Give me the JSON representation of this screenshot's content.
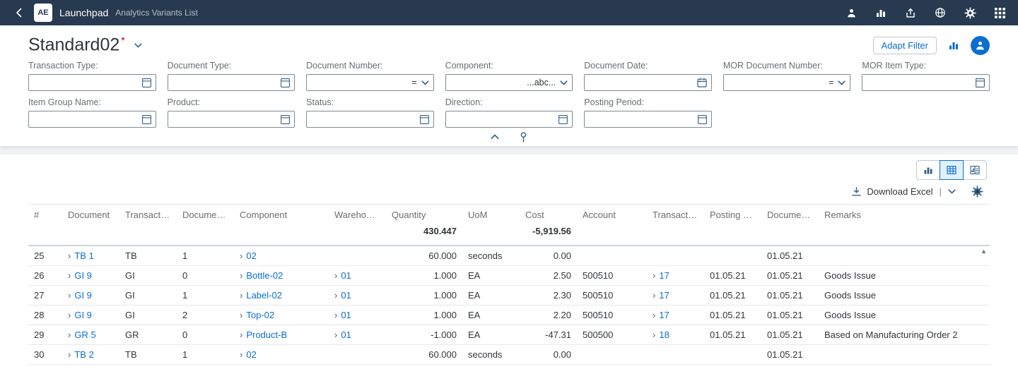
{
  "shell": {
    "app_initials": "AE",
    "title": "Launchpad",
    "subtitle": "Analytics Variants List",
    "actions": [
      "user-icon",
      "bar-chart-icon",
      "export-icon",
      "globe-icon",
      "settings-icon",
      "grid-icon"
    ]
  },
  "header": {
    "variant_title": "Standard02",
    "modified_marker": "*",
    "adapt_filter_label": "Adapt Filter"
  },
  "filter_bar": {
    "fields": [
      {
        "label": "Transaction Type:",
        "value": "",
        "icon": "value-help-icon",
        "row": 1,
        "col": 1
      },
      {
        "label": "Document Type:",
        "value": "",
        "icon": "value-help-icon",
        "row": 1,
        "col": 2
      },
      {
        "label": "Document Number:",
        "value": "",
        "operator": "=",
        "icon": "dropdown-icon",
        "row": 1,
        "col": 3
      },
      {
        "label": "Component:",
        "value": "",
        "operator": "...abc...",
        "icon": "dropdown-icon",
        "row": 1,
        "col": 4
      },
      {
        "label": "Document Date:",
        "value": "",
        "icon": "calendar-icon",
        "row": 1,
        "col": 5
      },
      {
        "label": "MOR Document Number:",
        "value": "",
        "operator": "=",
        "icon": "dropdown-icon",
        "row": 1,
        "col": 6
      },
      {
        "label": "MOR Item Type:",
        "value": "",
        "icon": "value-help-icon",
        "row": 1,
        "col": 7
      },
      {
        "label": "Item Group Name:",
        "value": "",
        "icon": "value-help-icon",
        "row": 2,
        "col": 1
      },
      {
        "label": "Product:",
        "value": "",
        "icon": "value-help-icon",
        "row": 2,
        "col": 2
      },
      {
        "label": "Status:",
        "value": "",
        "icon": "value-help-icon",
        "row": 2,
        "col": 3
      },
      {
        "label": "Direction:",
        "value": "",
        "icon": "value-help-icon",
        "row": 2,
        "col": 4
      },
      {
        "label": "Posting Period:",
        "value": "",
        "icon": "value-help-icon",
        "row": 2,
        "col": 5
      }
    ]
  },
  "table_card": {
    "view_switcher": [
      "chart-view-icon",
      "table-view-icon",
      "mixed-view-icon"
    ],
    "selected_view": "table-view-icon",
    "export_label": "Download Excel",
    "export_separator": "|",
    "table": {
      "columns": [
        "#",
        "Document",
        "Transaction...",
        "Document...",
        "Component",
        "Warehouse...",
        "Quantity",
        "UoM",
        "Cost",
        "Account",
        "Transaction...",
        "Posting Date",
        "Document...",
        "Remarks"
      ],
      "totals": [
        "",
        "",
        "",
        "",
        "",
        "",
        "430.447",
        "",
        "-5,919.56",
        "",
        "",
        "",
        "",
        ""
      ],
      "rows": [
        {
          "num": "25",
          "cells": [
            {
              "v": "TB 1",
              "link": true
            },
            {
              "v": "TB"
            },
            {
              "v": "1"
            },
            {
              "v": "02",
              "link": true
            },
            {
              "v": ""
            },
            {
              "v": "60.000"
            },
            {
              "v": "seconds"
            },
            {
              "v": "0.00"
            },
            {
              "v": ""
            },
            {
              "v": ""
            },
            {
              "v": ""
            },
            {
              "v": "01.05.21"
            },
            {
              "v": ""
            }
          ]
        },
        {
          "num": "26",
          "cells": [
            {
              "v": "GI 9",
              "link": true
            },
            {
              "v": "GI"
            },
            {
              "v": "0"
            },
            {
              "v": "Bottle-02",
              "link": true
            },
            {
              "v": "01",
              "link": true
            },
            {
              "v": "1.000"
            },
            {
              "v": "EA"
            },
            {
              "v": "2.50"
            },
            {
              "v": "500510"
            },
            {
              "v": "17",
              "link": true
            },
            {
              "v": "01.05.21"
            },
            {
              "v": "01.05.21"
            },
            {
              "v": "Goods Issue"
            }
          ]
        },
        {
          "num": "27",
          "cells": [
            {
              "v": "GI 9",
              "link": true
            },
            {
              "v": "GI"
            },
            {
              "v": "1"
            },
            {
              "v": "Label-02",
              "link": true
            },
            {
              "v": "01",
              "link": true
            },
            {
              "v": "1.000"
            },
            {
              "v": "EA"
            },
            {
              "v": "2.30"
            },
            {
              "v": "500510"
            },
            {
              "v": "17",
              "link": true
            },
            {
              "v": "01.05.21"
            },
            {
              "v": "01.05.21"
            },
            {
              "v": "Goods Issue"
            }
          ]
        },
        {
          "num": "28",
          "cells": [
            {
              "v": "GI 9",
              "link": true
            },
            {
              "v": "GI"
            },
            {
              "v": "2"
            },
            {
              "v": "Top-02",
              "link": true
            },
            {
              "v": "01",
              "link": true
            },
            {
              "v": "1.000"
            },
            {
              "v": "EA"
            },
            {
              "v": "2.20"
            },
            {
              "v": "500510"
            },
            {
              "v": "17",
              "link": true
            },
            {
              "v": "01.05.21"
            },
            {
              "v": "01.05.21"
            },
            {
              "v": "Goods Issue"
            }
          ]
        },
        {
          "num": "29",
          "cells": [
            {
              "v": "GR 5",
              "link": true
            },
            {
              "v": "GR"
            },
            {
              "v": "0"
            },
            {
              "v": "Product-B",
              "link": true
            },
            {
              "v": "01",
              "link": true
            },
            {
              "v": "-1.000"
            },
            {
              "v": "EA"
            },
            {
              "v": "-47.31"
            },
            {
              "v": "500500"
            },
            {
              "v": "18",
              "link": true
            },
            {
              "v": "01.05.21"
            },
            {
              "v": "01.05.21"
            },
            {
              "v": "Based on Manufacturing Order 2"
            }
          ]
        },
        {
          "num": "30",
          "cells": [
            {
              "v": "TB 2",
              "link": true
            },
            {
              "v": "TB"
            },
            {
              "v": "1"
            },
            {
              "v": "02",
              "link": true
            },
            {
              "v": ""
            },
            {
              "v": "60.000"
            },
            {
              "v": "seconds"
            },
            {
              "v": "0.00"
            },
            {
              "v": ""
            },
            {
              "v": ""
            },
            {
              "v": ""
            },
            {
              "v": "01.05.21"
            },
            {
              "v": ""
            }
          ]
        }
      ]
    }
  }
}
